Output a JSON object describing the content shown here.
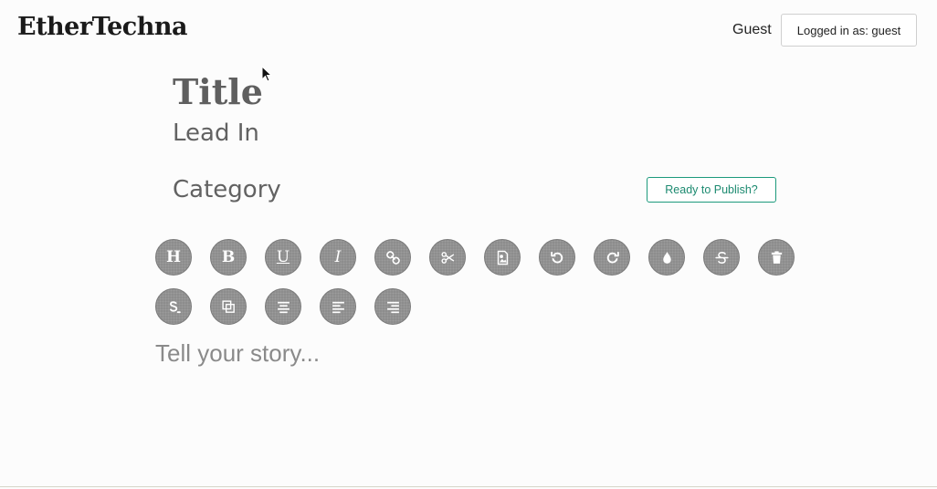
{
  "header": {
    "brand": "EtherTechna",
    "user_name": "Guest",
    "login_status": "Logged in as: guest"
  },
  "editor": {
    "title_placeholder": "Title",
    "leadin_placeholder": "Lead In",
    "category_placeholder": "Category",
    "publish_label": "Ready to Publish?",
    "story_placeholder": "Tell your story..."
  },
  "toolbar": {
    "row1": [
      "heading-icon",
      "bold-icon",
      "underline-icon",
      "italic-icon",
      "link-icon",
      "cut-icon",
      "image-icon",
      "undo-icon",
      "redo-icon",
      "color-drop-icon",
      "strikethrough-icon",
      "trash-icon"
    ],
    "row2": [
      "clear-format-icon",
      "copy-icon",
      "align-center-icon",
      "align-left-icon",
      "align-right-icon"
    ],
    "glyphs": {
      "heading": "H",
      "bold": "B",
      "underline": "U",
      "italic": "I"
    }
  },
  "colors": {
    "accent": "#1c9a7c",
    "toolbar_button": "#8d8d8d",
    "background": "#fcfcfc"
  }
}
